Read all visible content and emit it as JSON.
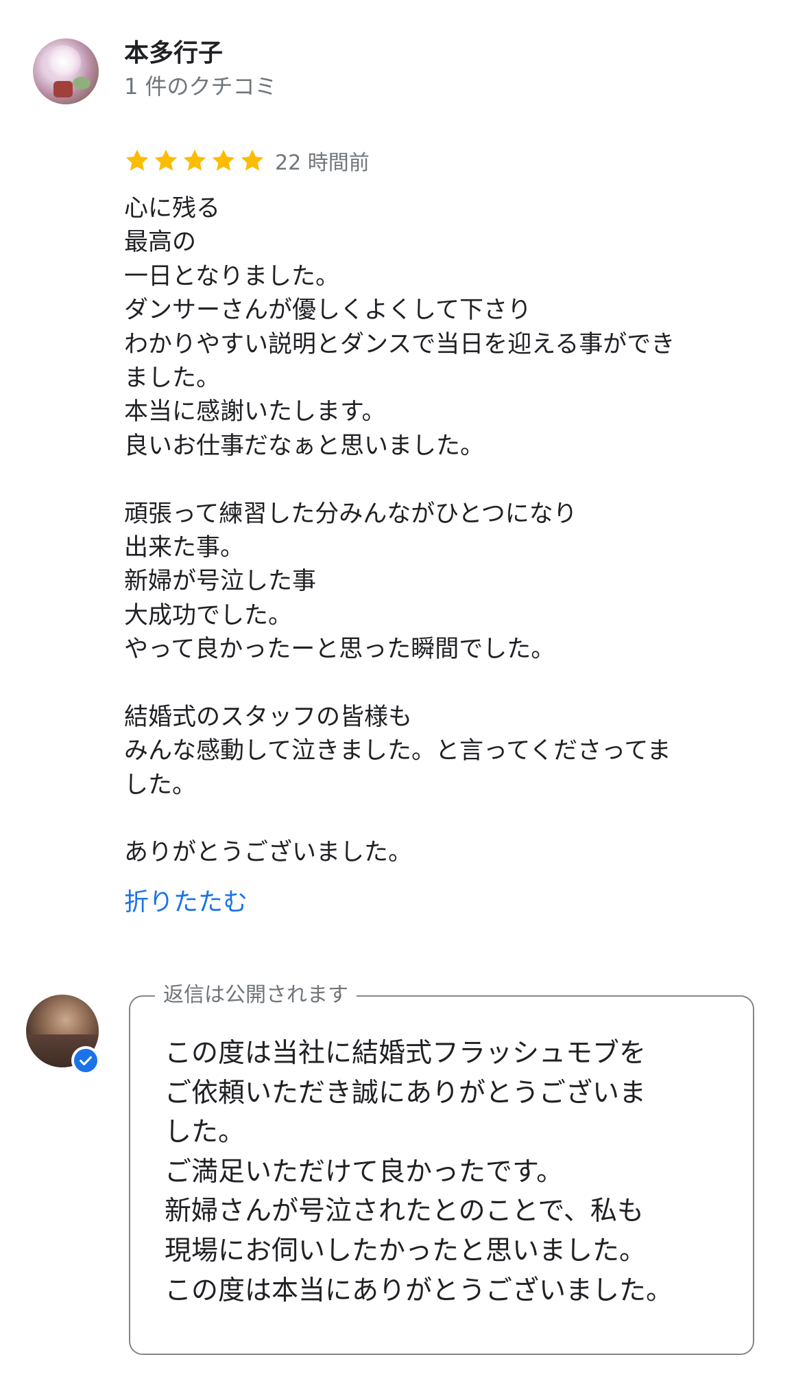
{
  "reviewer": {
    "name": "本多行子",
    "review_count": "1 件のクチコミ",
    "avatar_icon": "user-photo-avatar"
  },
  "review": {
    "rating": 5,
    "rating_max": 5,
    "star_color": "#fbbc04",
    "time_ago": "22 時間前",
    "lines": [
      "心に残る",
      "最高の",
      "一日となりました。",
      "ダンサーさんが優しくよくして下さり",
      "わかりやすい説明とダンスで当日を迎える事ができ",
      "ました。",
      "本当に感謝いたします。",
      "良いお仕事だなぁと思いました。",
      "",
      "頑張って練習した分みんながひとつになり",
      "出来た事。",
      "新婦が号泣した事",
      "大成功でした。",
      "やって良かったーと思った瞬間でした。",
      "",
      "結婚式のスタッフの皆様も",
      "みんな感動して泣きました。と言ってくださってま",
      "した。",
      "",
      "ありがとうございました。"
    ],
    "collapse_label": "折りたたむ",
    "link_color": "#1a73e8"
  },
  "owner_reply": {
    "avatar_icon": "business-photo-avatar",
    "verified_icon": "verified-check-icon",
    "badge_color": "#1a73e8",
    "legend": "返信は公開されます",
    "lines": [
      "この度は当社に結婚式フラッシュモブを",
      "ご依頼いただき誠にありがとうございま",
      "した。",
      "ご満足いただけて良かったです。",
      "新婦さんが号泣されたとのことで、私も",
      "現場にお伺いしたかったと思いました。",
      "この度は本当にありがとうございました。"
    ]
  }
}
